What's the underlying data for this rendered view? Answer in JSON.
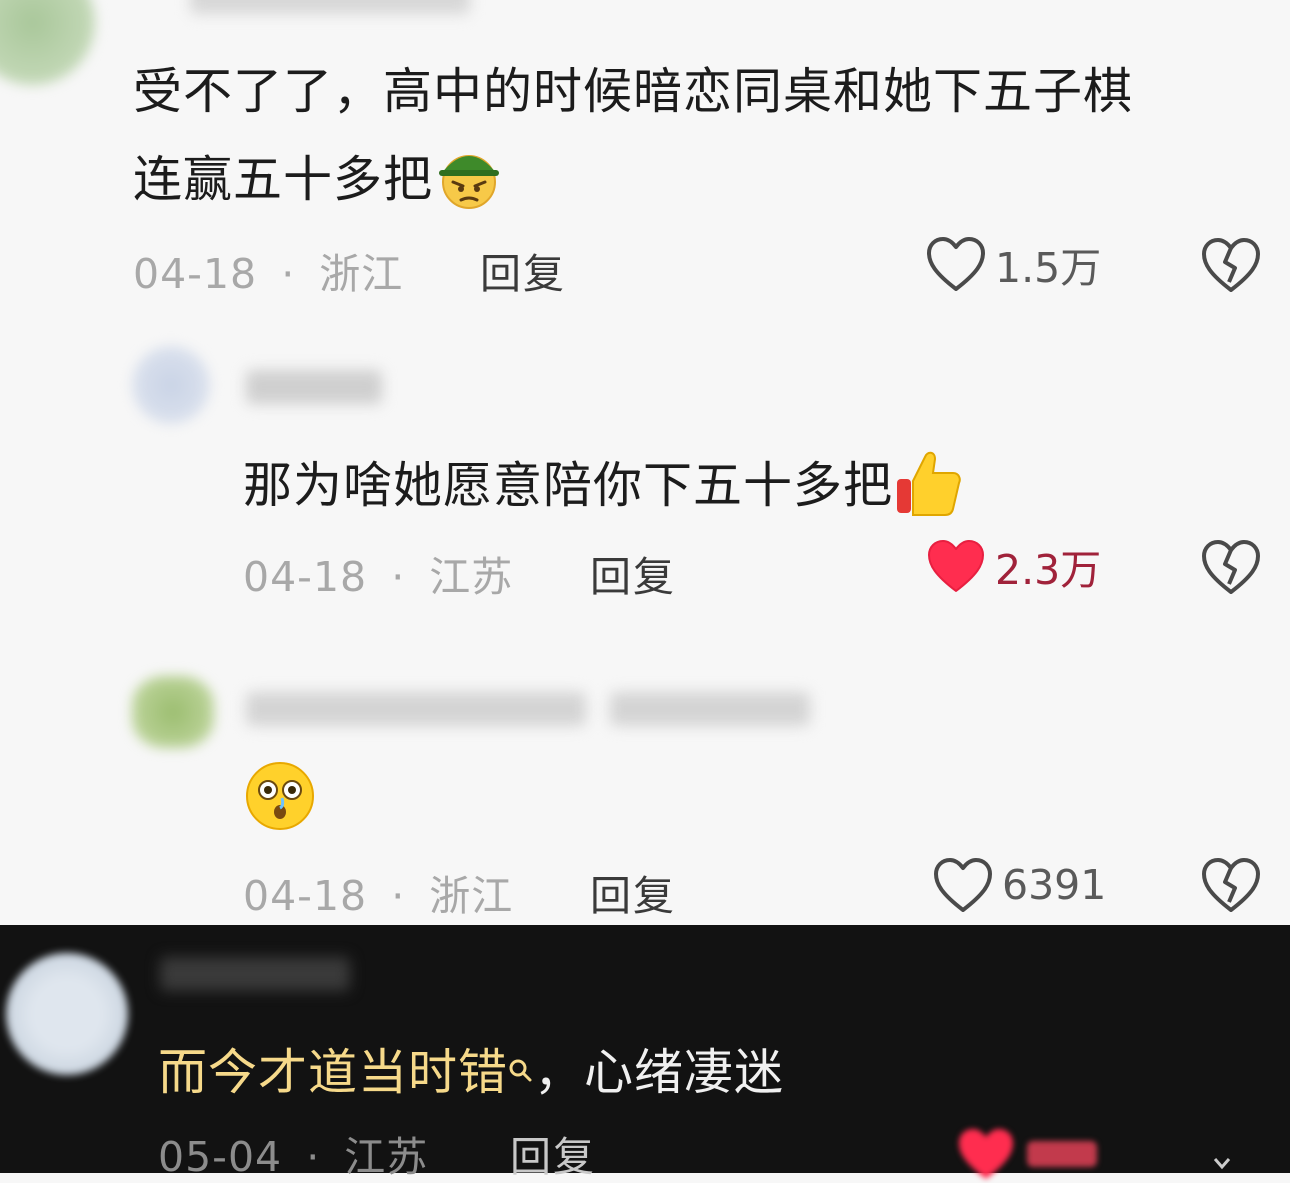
{
  "comments": [
    {
      "text": "受不了了，高中的时候暗恋同桌和她下五子棋",
      "text2": "连赢五十多把",
      "emoji": "angry-cap-face-emoji",
      "date": "04-18",
      "location": "浙江",
      "reply": "回复",
      "likes": "1.5万",
      "liked": false
    },
    {
      "text": "那为啥她愿意陪你下五十多把",
      "emoji": "thumbs-up-emoji",
      "date": "04-18",
      "location": "江苏",
      "reply": "回复",
      "likes": "2.3万",
      "liked": true
    },
    {
      "text": "",
      "emoji": "surprised-face-emoji",
      "date": "04-18",
      "location": "浙江",
      "reply": "回复",
      "likes": "6391",
      "liked": false
    },
    {
      "text_highlight": "而今才道当时错",
      "text_rest": "，心绪凄迷",
      "date": "05-04",
      "location": "江苏",
      "reply": "回复",
      "liked": true
    }
  ],
  "separator": "·",
  "colors": {
    "liked_heart": "#ff2d4f",
    "highlight_text": "#f6d98a",
    "dark_bg": "#121212",
    "page_bg": "#f7f7f7"
  }
}
